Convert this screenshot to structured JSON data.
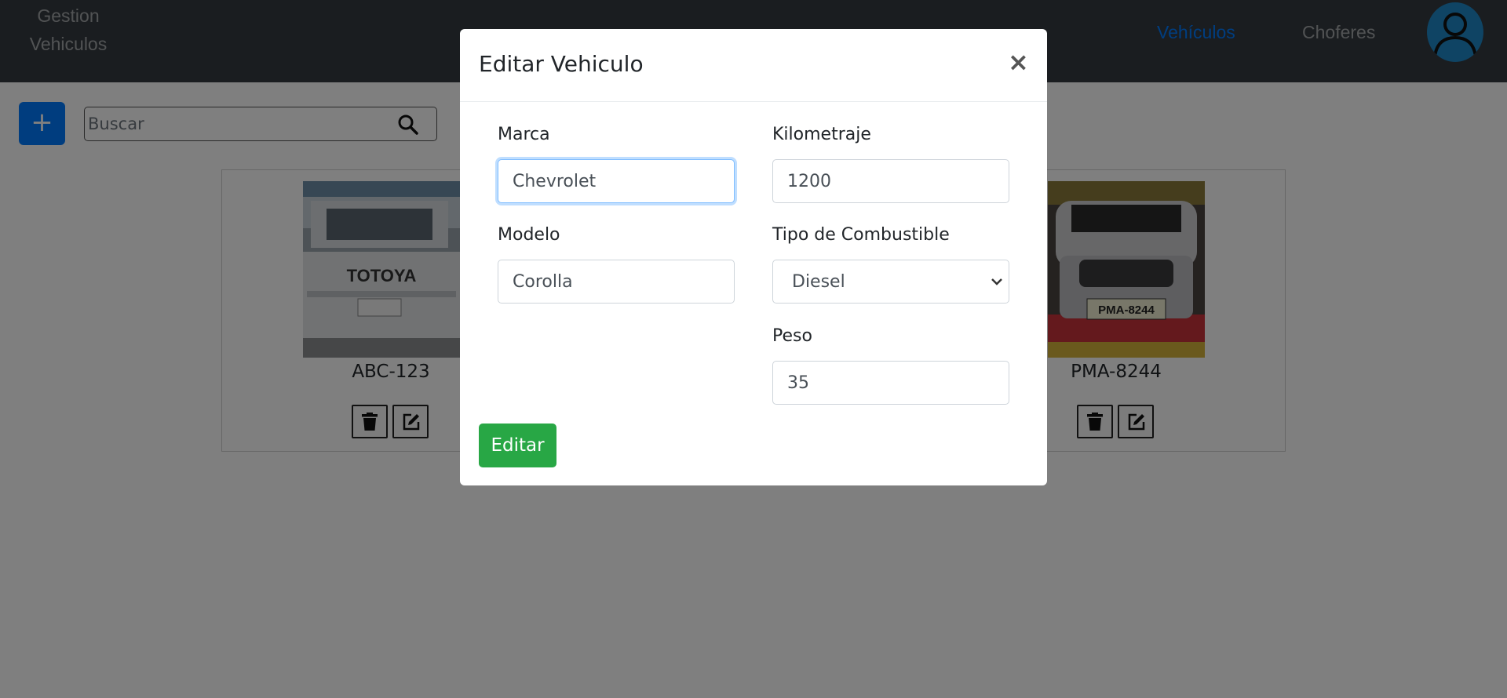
{
  "navbar": {
    "brand_line1": "Gestion",
    "brand_line2": "Vehiculos",
    "links": [
      {
        "label": "Vehículos",
        "active": true
      },
      {
        "label": "Choferes",
        "active": false
      }
    ],
    "active_color": "#007bff"
  },
  "toolbar": {
    "add_label": "+",
    "search_placeholder": "Buscar",
    "search_icon": "search-icon"
  },
  "cards": [
    {
      "plate": "ABC-123",
      "image_text": "TOTOYA",
      "actions": [
        "trash-icon",
        "edit-icon"
      ]
    },
    {
      "plate": "PMA-8244",
      "image_text": "PMA-8244",
      "actions": [
        "trash-icon",
        "edit-icon"
      ]
    }
  ],
  "modal": {
    "title": "Editar Vehiculo",
    "close_label": "×",
    "fields": {
      "marca": {
        "label": "Marca",
        "value": "Chevrolet"
      },
      "kilometraje": {
        "label": "Kilometraje",
        "value": "1200"
      },
      "modelo": {
        "label": "Modelo",
        "value": "Corolla"
      },
      "combustible": {
        "label": "Tipo de Combustible",
        "value": "Diesel"
      },
      "peso": {
        "label": "Peso",
        "value": "35"
      }
    },
    "submit_label": "Editar",
    "submit_color": "#28a745"
  }
}
